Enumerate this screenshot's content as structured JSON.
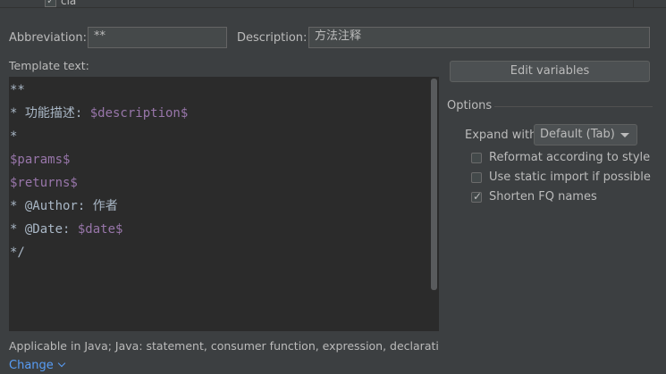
{
  "top_list": {
    "item_label": "cla",
    "checked": true
  },
  "abbreviation": {
    "label": "Abbreviation:",
    "value": "**"
  },
  "description": {
    "label": "Description:",
    "value": "方法注释"
  },
  "template": {
    "label": "Template text:",
    "lines": [
      [
        {
          "t": "**",
          "k": "txt"
        }
      ],
      [
        {
          "t": "* 功能描述: ",
          "k": "txt"
        },
        {
          "t": "$description$",
          "k": "var"
        }
      ],
      [
        {
          "t": "*",
          "k": "txt"
        }
      ],
      [
        {
          "t": "$params$",
          "k": "var"
        }
      ],
      [
        {
          "t": "$returns$",
          "k": "var"
        }
      ],
      [
        {
          "t": "* @Author: 作者",
          "k": "txt"
        }
      ],
      [
        {
          "t": "* @Date: ",
          "k": "txt"
        },
        {
          "t": "$date$",
          "k": "var"
        }
      ],
      [
        {
          "t": "*/",
          "k": "txt"
        }
      ]
    ]
  },
  "edit_variables_label": "Edit variables",
  "options": {
    "title": "Options",
    "expand_with_label": "Expand with",
    "expand_with_value": "Default (Tab)",
    "checkboxes": [
      {
        "label": "Reformat according to style",
        "checked": false
      },
      {
        "label": "Use static import if possible",
        "checked": false
      },
      {
        "label": "Shorten FQ names",
        "checked": true
      }
    ]
  },
  "applicable_text": "Applicable in Java; Java: statement, consumer function, expression, declaration, c...",
  "change_label": "Change",
  "colors": {
    "accent_link": "#589df6",
    "template_variable": "#9876aa",
    "editor_bg": "#2b2b2b"
  }
}
